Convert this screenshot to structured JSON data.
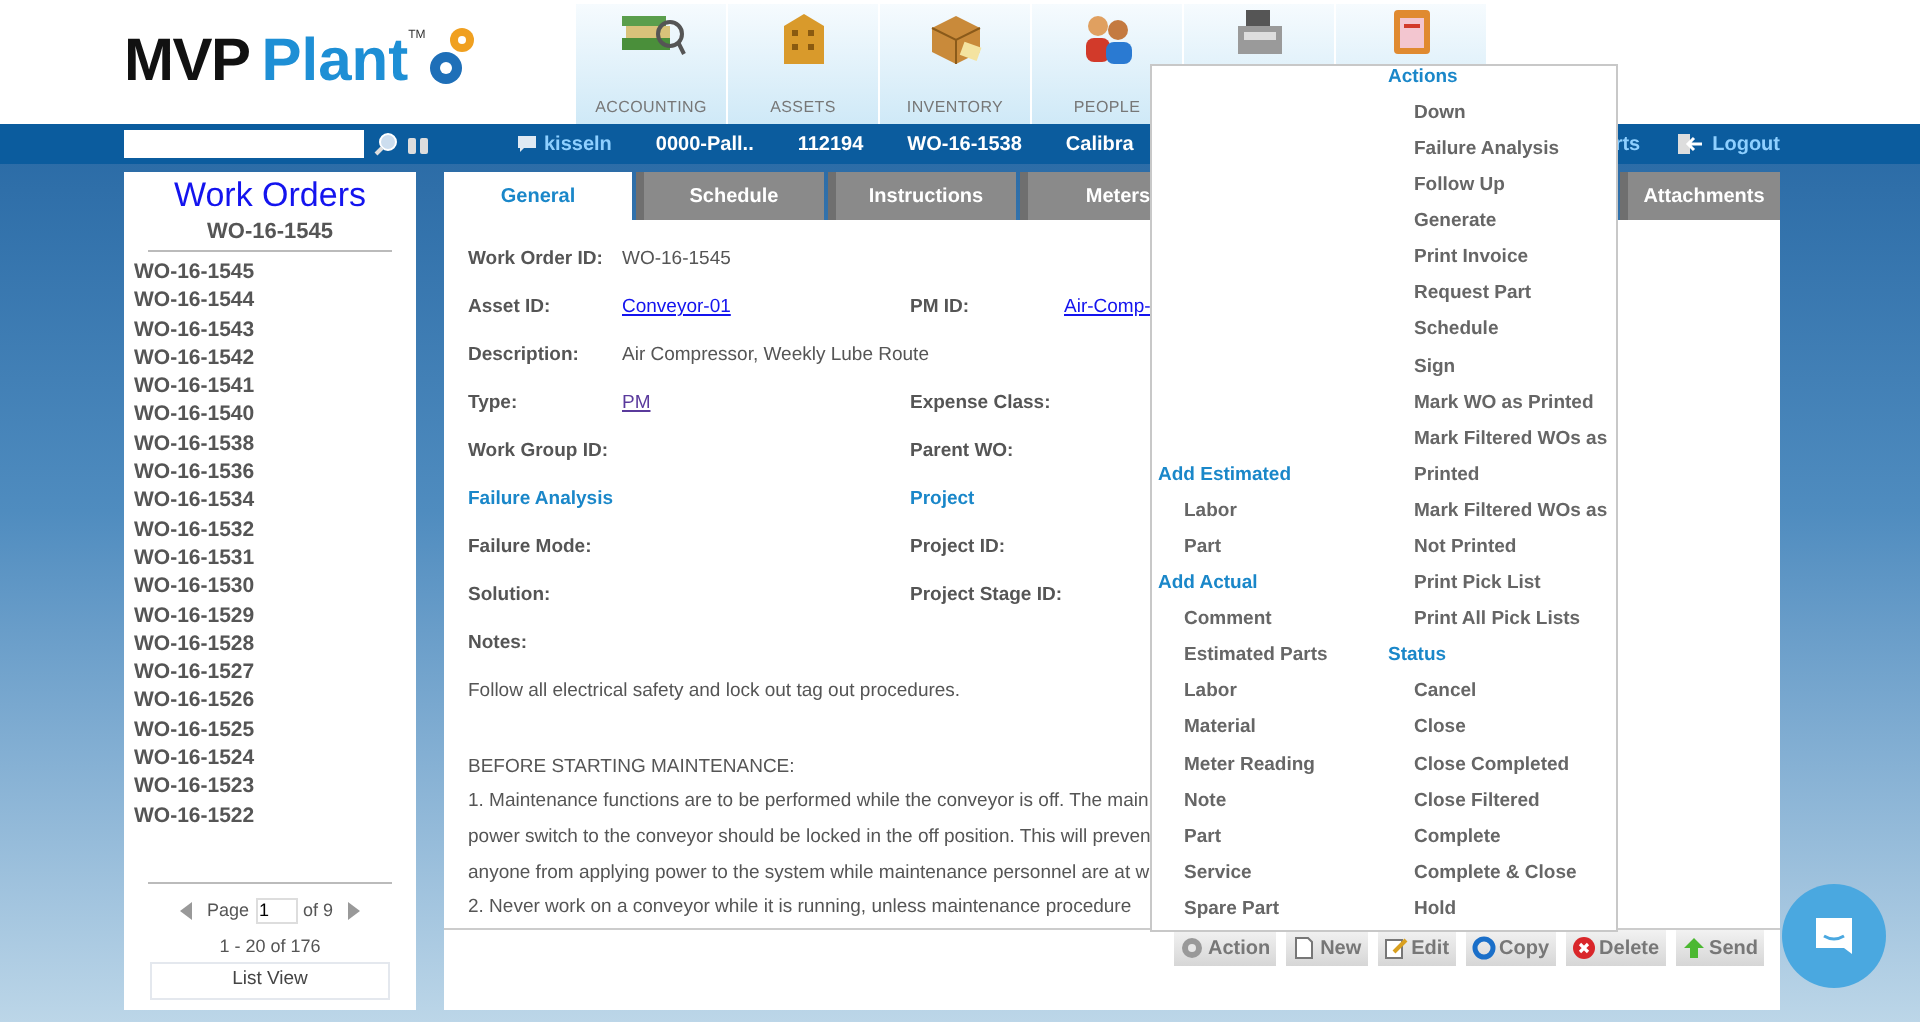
{
  "logo": {
    "brand": "MVP",
    "product": "Plant",
    "mark": "TM"
  },
  "modules": [
    {
      "kind": "labeled",
      "label": "ACCOUNTING"
    },
    {
      "kind": "labeled",
      "label": "ASSETS"
    },
    {
      "kind": "labeled",
      "label": "INVENTORY"
    },
    {
      "kind": "labeled",
      "label": "PEOPLE"
    },
    {
      "kind": "covered"
    },
    {
      "kind": "covered"
    }
  ],
  "top_bar": {
    "user": "kisseln",
    "items": [
      "0000-Pall..",
      "112194",
      "WO-16-1538",
      "Calibra"
    ],
    "cut_link": "rts",
    "logout": "Logout"
  },
  "sidebar": {
    "title": "Work Orders",
    "subtitle": "WO-16-1545",
    "items": [
      "WO-16-1545",
      "WO-16-1544",
      "WO-16-1543",
      "WO-16-1542",
      "WO-16-1541",
      "WO-16-1540",
      "WO-16-1538",
      "WO-16-1536",
      "WO-16-1534",
      "WO-16-1532",
      "WO-16-1531",
      "WO-16-1530",
      "WO-16-1529",
      "WO-16-1528",
      "WO-16-1527",
      "WO-16-1526",
      "WO-16-1525",
      "WO-16-1524",
      "WO-16-1523",
      "WO-16-1522"
    ],
    "pager": {
      "page_label": "Page",
      "page": "1",
      "of": "of 9",
      "range": "1 - 20 of 176"
    },
    "view_button": "List View"
  },
  "tabs": [
    {
      "label": "General",
      "selected": true
    },
    {
      "label": "Schedule",
      "selected": false
    },
    {
      "label": "Instructions",
      "selected": false
    },
    {
      "label": "Meters",
      "selected": false
    },
    {
      "label": "Attachments",
      "selected": false
    }
  ],
  "form": [
    {
      "kind": "field",
      "cells": [
        {
          "label": "Work Order ID:",
          "value": "WO-16-1545",
          "link": false
        }
      ]
    },
    {
      "kind": "field",
      "cells": [
        {
          "label": "Asset ID:",
          "value": "Conveyor-01",
          "link": true,
          "visited": false
        },
        {
          "label": "PM ID:",
          "value": "Air-Comp-",
          "link": true,
          "visited": false
        }
      ]
    },
    {
      "kind": "field",
      "cells": [
        {
          "label": "Description:",
          "value": "Air Compressor, Weekly Lube Route",
          "link": false
        }
      ]
    },
    {
      "kind": "field",
      "cells": [
        {
          "label": "Type:",
          "value": "PM",
          "link": true,
          "visited": true
        },
        {
          "label": "Expense Class:"
        }
      ]
    },
    {
      "kind": "field",
      "cells": [
        {
          "label": "Work Group ID:"
        },
        {
          "label": "Parent WO:"
        }
      ]
    },
    {
      "kind": "section",
      "cells": [
        {
          "label": "Failure Analysis"
        },
        {
          "label": "Project"
        }
      ]
    },
    {
      "kind": "field",
      "cells": [
        {
          "label": "Failure Mode:"
        },
        {
          "label": "Project ID:"
        }
      ]
    },
    {
      "kind": "field",
      "cells": [
        {
          "label": "Solution:"
        },
        {
          "label": "Project Stage ID:"
        }
      ]
    }
  ],
  "notes": {
    "label": "Notes:",
    "first": "Follow all electrical safety and lock out tag out procedures.",
    "heading": "BEFORE STARTING MAINTENANCE:",
    "lines": [
      "1. Maintenance functions are to be performed while the conveyor is off. The main",
      "power switch to the conveyor should be locked in the off position. This will preven",
      "anyone from applying power to the system while maintenance personnel are at w",
      "2. Never work on a conveyor while it is running, unless maintenance procedure"
    ]
  },
  "action_menu": {
    "columns": [
      [
        {
          "heading": "Add Estimated",
          "items": [
            "Labor",
            "Part"
          ]
        },
        {
          "heading": "Add Actual",
          "items": [
            "Comment",
            "Estimated Parts",
            "Labor",
            "Material",
            "Meter Reading",
            "Note",
            "Part",
            "Service",
            "Spare Part"
          ]
        }
      ],
      [
        {
          "heading": "Actions",
          "items": [
            "Down",
            "Failure Analysis",
            "Follow Up",
            "Generate",
            "Print Invoice",
            "Request Part",
            "Schedule",
            "Sign",
            "Mark WO as Printed",
            "Mark Filtered WOs as Printed",
            "Mark Filtered WOs as Not Printed",
            "Print Pick List",
            "Print All Pick Lists"
          ]
        },
        {
          "heading": "Status",
          "items": [
            "Cancel",
            "Close",
            "Close Completed",
            "Close Filtered",
            "Complete",
            "Complete & Close",
            "Hold"
          ]
        }
      ]
    ]
  },
  "toolbar": [
    "Action",
    "New",
    "Edit",
    "Copy",
    "Delete",
    "Send"
  ]
}
